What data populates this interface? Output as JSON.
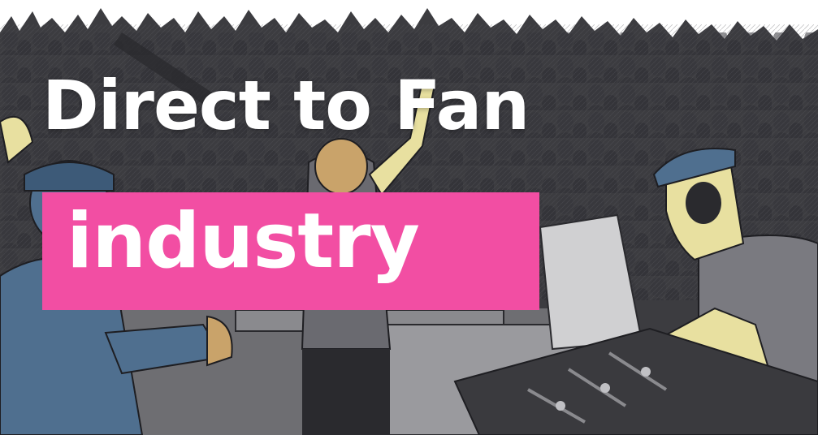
{
  "banner": {
    "headline": "Direct to Fan",
    "tag": "industry"
  },
  "colors": {
    "tag_background": "#f24ea3",
    "text": "#ffffff",
    "crowd": "#3c3c40",
    "crowd_dark": "#2a2a2e",
    "skin": "#e8e0a0",
    "blue_shirt": "#4f6f8f",
    "grey_shirt": "#7a7a80"
  },
  "icons": [
    "concert-crowd-illustration"
  ]
}
